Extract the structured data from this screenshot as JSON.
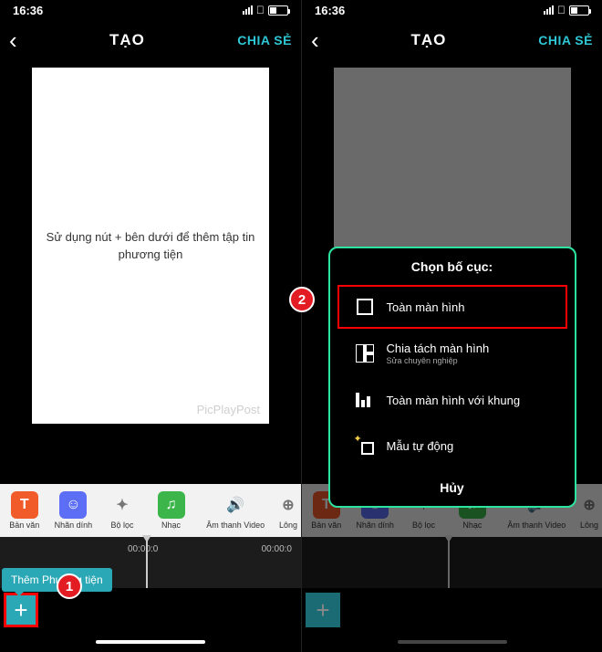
{
  "status": {
    "time": "16:36"
  },
  "nav": {
    "title": "TẠO",
    "share": "CHIA SẺ"
  },
  "canvas": {
    "hint_line1": "Sử dụng nút + bên dưới để thêm tập tin",
    "hint_line2": "phương tiện",
    "watermark": "PicPlayPost"
  },
  "tools": {
    "text": "Bản văn",
    "sticker": "Nhãn dính",
    "filter": "Bộ lọc",
    "music": "Nhạc",
    "audio": "Âm thanh Video",
    "fur": "Lông"
  },
  "timeline": {
    "t0": "00:00:0",
    "t1": "00:00:0"
  },
  "tooltip": "Thêm Phương tiện",
  "steps": {
    "s1": "1",
    "s2": "2"
  },
  "modal": {
    "title": "Chọn bố cục:",
    "item1": "Toàn màn hình",
    "item2": "Chia tách màn hình",
    "item2_sub": "Sửa chuyên nghiệp",
    "item3": "Toàn màn hình với khung",
    "item4": "Mẫu tự động",
    "cancel": "Hủy"
  }
}
